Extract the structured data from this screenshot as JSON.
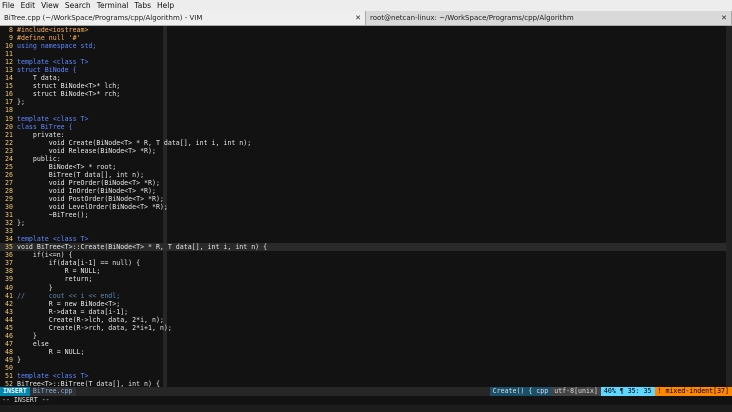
{
  "menu": [
    "File",
    "Edit",
    "View",
    "Search",
    "Terminal",
    "Tabs",
    "Help"
  ],
  "tabs": [
    {
      "title": "BiTree.cpp (~/WorkSpace/Programs/cpp/Algorithm) - VIM",
      "close": "✕"
    },
    {
      "title": "root@netcan-linux: ~/WorkSpace/Programs/cpp/Algorithm",
      "close": "✕"
    }
  ],
  "code": [
    {
      "n": "8",
      "t": "#include<iostream>",
      "c": "pp"
    },
    {
      "n": "9",
      "t": "#define null '#'",
      "c": "pp"
    },
    {
      "n": "10",
      "t": "using namespace std;",
      "c": "kw"
    },
    {
      "n": "11",
      "t": "",
      "c": ""
    },
    {
      "n": "12",
      "t": "template <class T>",
      "c": "kw"
    },
    {
      "n": "13",
      "t": "struct BiNode {",
      "c": "kw"
    },
    {
      "n": "14",
      "t": "    T data;",
      "c": ""
    },
    {
      "n": "15",
      "t": "    struct BiNode<T>* lch;",
      "c": ""
    },
    {
      "n": "16",
      "t": "    struct BiNode<T>* rch;",
      "c": ""
    },
    {
      "n": "17",
      "t": "};",
      "c": ""
    },
    {
      "n": "18",
      "t": "",
      "c": ""
    },
    {
      "n": "19",
      "t": "template <class T>",
      "c": "kw"
    },
    {
      "n": "20",
      "t": "class BiTree {",
      "c": "kw"
    },
    {
      "n": "21",
      "t": "    private:",
      "c": ""
    },
    {
      "n": "22",
      "t": "        void Create(BiNode<T> * R, T data[], int i, int n);",
      "c": ""
    },
    {
      "n": "23",
      "t": "        void Release(BiNode<T> *R);",
      "c": ""
    },
    {
      "n": "24",
      "t": "    public:",
      "c": ""
    },
    {
      "n": "25",
      "t": "        BiNode<T> * root;",
      "c": ""
    },
    {
      "n": "26",
      "t": "        BiTree(T data[], int n);",
      "c": ""
    },
    {
      "n": "27",
      "t": "        void PreOrder(BiNode<T> *R);",
      "c": ""
    },
    {
      "n": "28",
      "t": "        void InOrder(BiNode<T> *R);",
      "c": ""
    },
    {
      "n": "29",
      "t": "        void PostOrder(BiNode<T> *R);",
      "c": ""
    },
    {
      "n": "30",
      "t": "        void LevelOrder(BiNode<T> *R);",
      "c": ""
    },
    {
      "n": "31",
      "t": "        ~BiTree();",
      "c": ""
    },
    {
      "n": "32",
      "t": "};",
      "c": ""
    },
    {
      "n": "33",
      "t": "",
      "c": ""
    },
    {
      "n": "34",
      "t": "template <class T>",
      "c": "kw"
    },
    {
      "n": "35",
      "t": "void BiTree<T>::Create(BiNode<T> * R, T data[], int i, int n) {",
      "c": "cur"
    },
    {
      "n": "36",
      "t": "    if(i<=n) {",
      "c": ""
    },
    {
      "n": "37",
      "t": "        if(data[i-1] == null) {",
      "c": ""
    },
    {
      "n": "38",
      "t": "            R = NULL;",
      "c": ""
    },
    {
      "n": "39",
      "t": "            return;",
      "c": ""
    },
    {
      "n": "40",
      "t": "        }",
      "c": ""
    },
    {
      "n": "41",
      "t": "//      cout << i << endl;",
      "c": "cm"
    },
    {
      "n": "42",
      "t": "        R = new BiNode<T>;",
      "c": ""
    },
    {
      "n": "43",
      "t": "        R->data = data[i-1];",
      "c": ""
    },
    {
      "n": "44",
      "t": "        Create(R->lch, data, 2*i, n);",
      "c": ""
    },
    {
      "n": "45",
      "t": "        Create(R->rch, data, 2*i+1, n);",
      "c": ""
    },
    {
      "n": "46",
      "t": "    }",
      "c": ""
    },
    {
      "n": "47",
      "t": "    else",
      "c": ""
    },
    {
      "n": "48",
      "t": "        R = NULL;",
      "c": ""
    },
    {
      "n": "49",
      "t": "}",
      "c": ""
    },
    {
      "n": "50",
      "t": "",
      "c": ""
    },
    {
      "n": "51",
      "t": "template <class T>",
      "c": "kw"
    },
    {
      "n": "52",
      "t": "BiTree<T>::BiTree(T data[], int n) {",
      "c": ""
    }
  ],
  "status": {
    "mode": "INSERT",
    "file": "BiTree.cpp",
    "func": "Create() { cpp",
    "encoding": "utf-8[unix]",
    "position": "40% ¶  35: 35",
    "warning": "! mixed-indent[37]"
  },
  "cmdline": "-- INSERT --"
}
